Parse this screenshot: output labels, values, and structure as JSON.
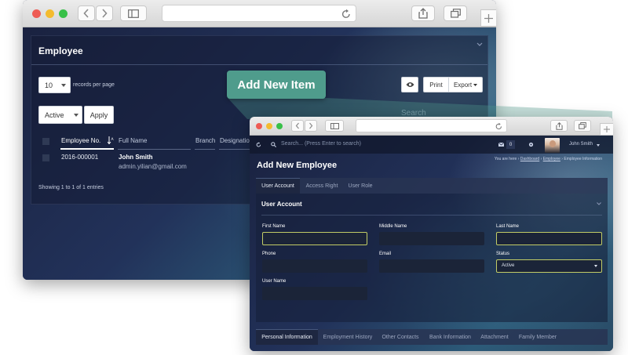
{
  "colors": {
    "accent_green": "#4f9c8c",
    "highlight_field": "#c2cc66"
  },
  "back_window": {
    "title": "Employee",
    "page_size": "10",
    "page_size_suffix": "records per page",
    "status_filter": "Active",
    "apply_label": "Apply",
    "print_label": "Print",
    "export_label": "Export",
    "search_placeholder": "Search",
    "columns": [
      "Employee No.",
      "Full Name",
      "Branch",
      "Designation"
    ],
    "rows": [
      {
        "employee_no": "2016-000001",
        "full_name": "John Smith",
        "email": "admin.yilian@gmail.com"
      }
    ],
    "footer": "Showing 1 to 1 of 1 entries"
  },
  "callout": {
    "label": "Add New Item"
  },
  "front_window": {
    "search_placeholder": "Search... (Press Enter to search)",
    "mail_count": "0",
    "user_name": "John Smith",
    "page_title": "Add New Employee",
    "breadcrumb": {
      "prefix": "You are here",
      "items": [
        "Dashboard",
        "Employee",
        "Employee Information"
      ]
    },
    "tabs": [
      "User Account",
      "Access Right",
      "User Role"
    ],
    "section_title": "User Account",
    "fields": {
      "first_name": "First Name",
      "middle_name": "Middle Name",
      "last_name": "Last Name",
      "phone": "Phone",
      "email": "Email",
      "status": "Status",
      "user_name": "User Name"
    },
    "status_value": "Active",
    "bottom_tabs": [
      "Personal Information",
      "Employment History",
      "Other Contacts",
      "Bank Information",
      "Attachment",
      "Family Member"
    ]
  }
}
